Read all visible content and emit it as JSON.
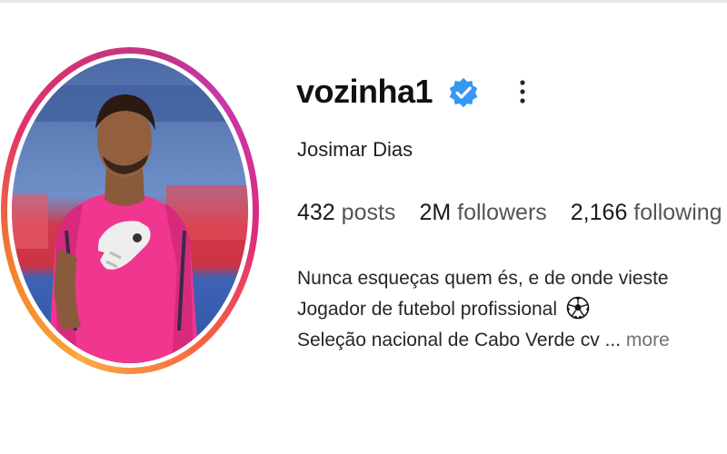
{
  "profile": {
    "username": "vozinha1",
    "verified": true,
    "full_name": "Josimar Dias",
    "avatar_icon": "profile-photo",
    "ring_colors": [
      "#f58529",
      "#dd2a7b",
      "#c837ab",
      "#fcaf45"
    ],
    "verified_color": "#3897f0"
  },
  "stats": {
    "posts_count": "432",
    "posts_label": "posts",
    "followers_count": "2M",
    "followers_label": "followers",
    "following_count": "2,166",
    "following_label": "following"
  },
  "bio": {
    "line1": "Nunca esqueças quem és, e de onde vieste",
    "line2": "Jogador de futebol profissional",
    "line2_icon": "soccer-ball-icon",
    "line3": "Seleção nacional de Cabo Verde cv ...",
    "more_label": "more"
  },
  "icons": {
    "options": "more-options-icon",
    "verified": "verified-badge-icon"
  }
}
